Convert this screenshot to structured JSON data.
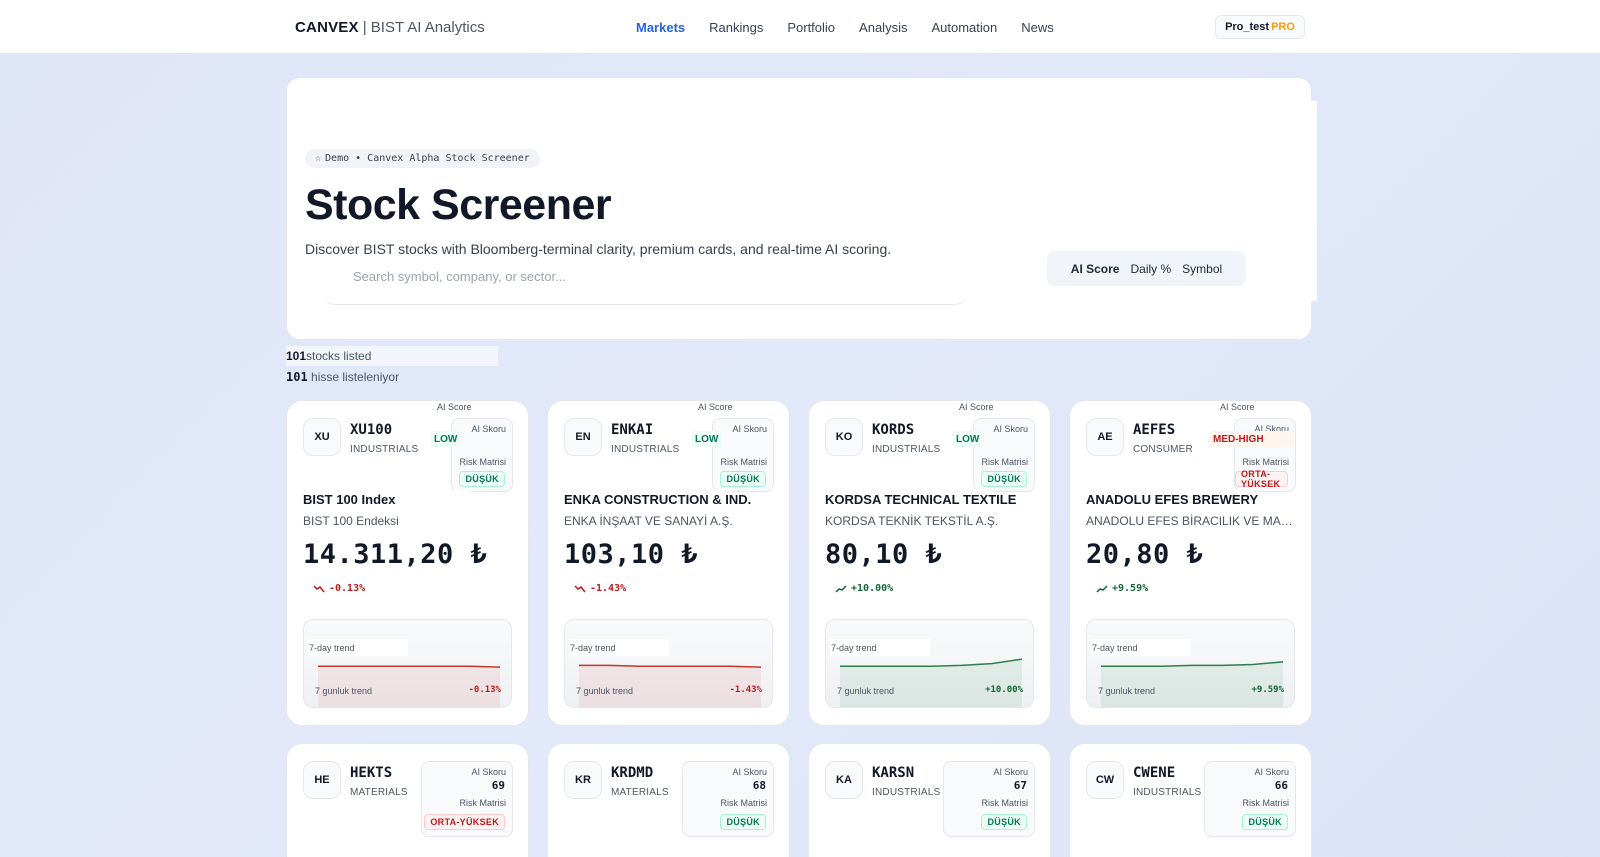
{
  "nav": {
    "brand": "CANVEX",
    "brand_sub": "| BIST AI Analytics",
    "links": [
      "Markets",
      "Rankings",
      "Portfolio",
      "Analysis",
      "Automation",
      "News"
    ],
    "user": "Pro_test",
    "pro": "PRO"
  },
  "hero": {
    "badge": "Demo • Canvex Alpha Stock Screener",
    "title": "Stock Screener",
    "subtitle": "Discover BIST stocks with Bloomberg-terminal clarity, premium cards, and real-time AI scoring.",
    "search_placeholder": "Search symbol, company, or sector...",
    "sort_options": [
      "AI Score",
      "Daily %",
      "Symbol"
    ]
  },
  "counts": {
    "n1": "101",
    "label_en": "stocks listed",
    "n2": "101",
    "label_tr": "hisse listeleniyor"
  },
  "labels": {
    "ai_score": "AI Score",
    "ai_skoru": "AI Skoru",
    "risk_matrisi": "Risk Matrisi",
    "trend_en": "7-day trend",
    "trend_tr": "7 gunluk trend"
  },
  "cards": [
    {
      "logo": "XU",
      "symbol": "XU100",
      "sector": "INDUSTRIALS",
      "risk_label": "LOW",
      "risk": "DÜŞÜK",
      "name_en": "BIST 100 Index",
      "name_tr": "BIST 100 Endeksi",
      "price": "14.311,20 ₺",
      "change": "-0.13%",
      "dir": "down",
      "trend": [
        0.52,
        0.52,
        0.52,
        0.52,
        0.52,
        0.52,
        0.53
      ]
    },
    {
      "logo": "EN",
      "symbol": "ENKAI",
      "sector": "INDUSTRIALS",
      "risk_label": "LOW",
      "risk": "DÜŞÜK",
      "name_en": "ENKA CONSTRUCTION & IND.",
      "name_tr": "ENKA İNŞAAT VE SANAYİ A.Ş.",
      "price": "103,10 ₺",
      "change": "-1.43%",
      "dir": "down",
      "trend": [
        0.51,
        0.51,
        0.52,
        0.52,
        0.52,
        0.52,
        0.53
      ]
    },
    {
      "logo": "KO",
      "symbol": "KORDS",
      "sector": "INDUSTRIALS",
      "risk_label": "LOW",
      "risk": "DÜŞÜK",
      "name_en": "KORDSA TECHNICAL TEXTILE",
      "name_tr": "KORDSA TEKNİK TEKSTİL A.Ş.",
      "price": "80,10 ₺",
      "change": "+10.00%",
      "dir": "up",
      "trend": [
        0.52,
        0.52,
        0.52,
        0.52,
        0.51,
        0.49,
        0.44
      ]
    },
    {
      "logo": "AE",
      "symbol": "AEFES",
      "sector": "CONSUMER",
      "risk_label": "MED-HIGH",
      "risk": "ORTA-YÜKSEK",
      "name_en": "ANADOLU EFES BREWERY",
      "name_tr": "ANADOLU EFES BİRACILIK VE MALT SANAYİİ",
      "price": "20,80 ₺",
      "change": "+9.59%",
      "dir": "up",
      "trend": [
        0.52,
        0.52,
        0.52,
        0.51,
        0.51,
        0.5,
        0.47
      ]
    }
  ],
  "cards_row2": [
    {
      "logo": "HE",
      "symbol": "HEKTS",
      "sector": "MATERIALS",
      "score": "69",
      "risk": "ORTA-YÜKSEK",
      "risk_level": "high"
    },
    {
      "logo": "KR",
      "symbol": "KRDMD",
      "sector": "MATERIALS",
      "score": "68",
      "risk": "DÜŞÜK",
      "risk_level": "low"
    },
    {
      "logo": "KA",
      "symbol": "KARSN",
      "sector": "INDUSTRIALS",
      "score": "67",
      "risk": "DÜŞÜK",
      "risk_level": "low"
    },
    {
      "logo": "CW",
      "symbol": "CWENE",
      "sector": "INDUSTRIALS",
      "score": "66",
      "risk": "DÜŞÜK",
      "risk_level": "low"
    }
  ],
  "colors": {
    "accent": "#2563eb",
    "down": "#b91c1c",
    "up": "#166534",
    "pro": "#f59e0b"
  }
}
